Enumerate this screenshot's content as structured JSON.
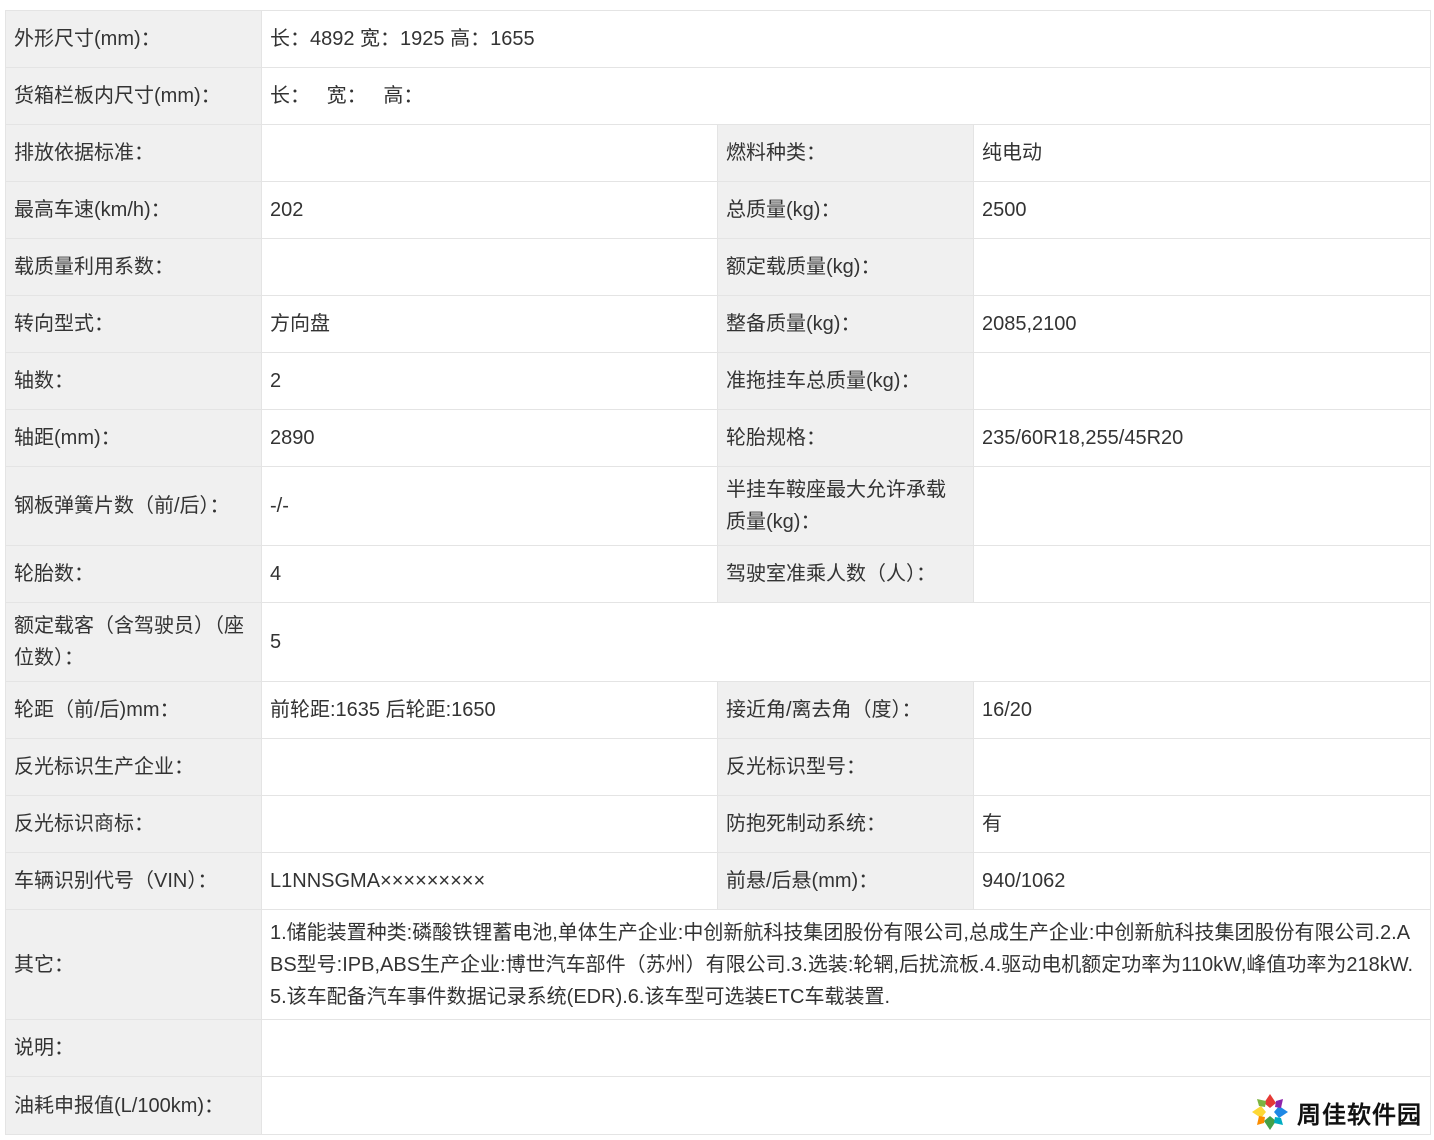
{
  "rows": {
    "dimensions": {
      "label": "外形尺寸(mm)：",
      "value": "长：4892 宽：1925 高：1655"
    },
    "cargo_box": {
      "label": "货箱栏板内尺寸(mm)：",
      "value": "长：   宽：   高："
    },
    "emission": {
      "label": "排放依据标准：",
      "value": "",
      "label2": "燃料种类：",
      "value2": "纯电动"
    },
    "max_speed": {
      "label": "最高车速(km/h)：",
      "value": "202",
      "label2": "总质量(kg)：",
      "value2": "2500"
    },
    "load_coeff": {
      "label": "载质量利用系数：",
      "value": "",
      "label2": "额定载质量(kg)：",
      "value2": ""
    },
    "steering": {
      "label": "转向型式：",
      "value": "方向盘",
      "label2": "整备质量(kg)：",
      "value2": "2085,2100"
    },
    "axles": {
      "label": "轴数：",
      "value": "2",
      "label2": "准拖挂车总质量(kg)：",
      "value2": ""
    },
    "wheelbase": {
      "label": "轴距(mm)：",
      "value": "2890",
      "label2": "轮胎规格：",
      "value2": "235/60R18,255/45R20"
    },
    "leaf_springs": {
      "label": "钢板弹簧片数（前/后）：",
      "value": "-/-",
      "label2": "半挂车鞍座最大允许承载质量(kg)：",
      "value2": ""
    },
    "tires": {
      "label": "轮胎数：",
      "value": "4",
      "label2": "驾驶室准乘人数（人）：",
      "value2": ""
    },
    "passengers": {
      "label": "额定载客（含驾驶员）（座位数）：",
      "value": "5"
    },
    "track": {
      "label": "轮距（前/后)mm：",
      "value": "前轮距:1635 后轮距:1650",
      "label2": "接近角/离去角（度）：",
      "value2": "16/20"
    },
    "reflective_maker": {
      "label": "反光标识生产企业：",
      "value": "",
      "label2": "反光标识型号：",
      "value2": ""
    },
    "reflective_brand": {
      "label": "反光标识商标：",
      "value": "",
      "label2": "防抱死制动系统：",
      "value2": "有"
    },
    "vin": {
      "label": "车辆识别代号（VIN）：",
      "value": "L1NNSGMA×××××××××",
      "label2": "前悬/后悬(mm)：",
      "value2": "940/1062"
    },
    "other": {
      "label": "其它：",
      "value": "1.储能装置种类:磷酸铁锂蓄电池,单体生产企业:中创新航科技集团股份有限公司,总成生产企业:中创新航科技集团股份有限公司.2.ABS型号:IPB,ABS生产企业:博世汽车部件（苏州）有限公司.3.选装:轮辋,后扰流板.4.驱动电机额定功率为110kW,峰值功率为218kW.5.该车配备汽车事件数据记录系统(EDR).6.该车型可选装ETC车载装置."
    },
    "note": {
      "label": "说明：",
      "value": ""
    },
    "fuel": {
      "label": "油耗申报值(L/100km)：",
      "value": ""
    }
  },
  "watermark": {
    "text": "周佳软件园",
    "icon": "pinwheel-logo-icon"
  }
}
